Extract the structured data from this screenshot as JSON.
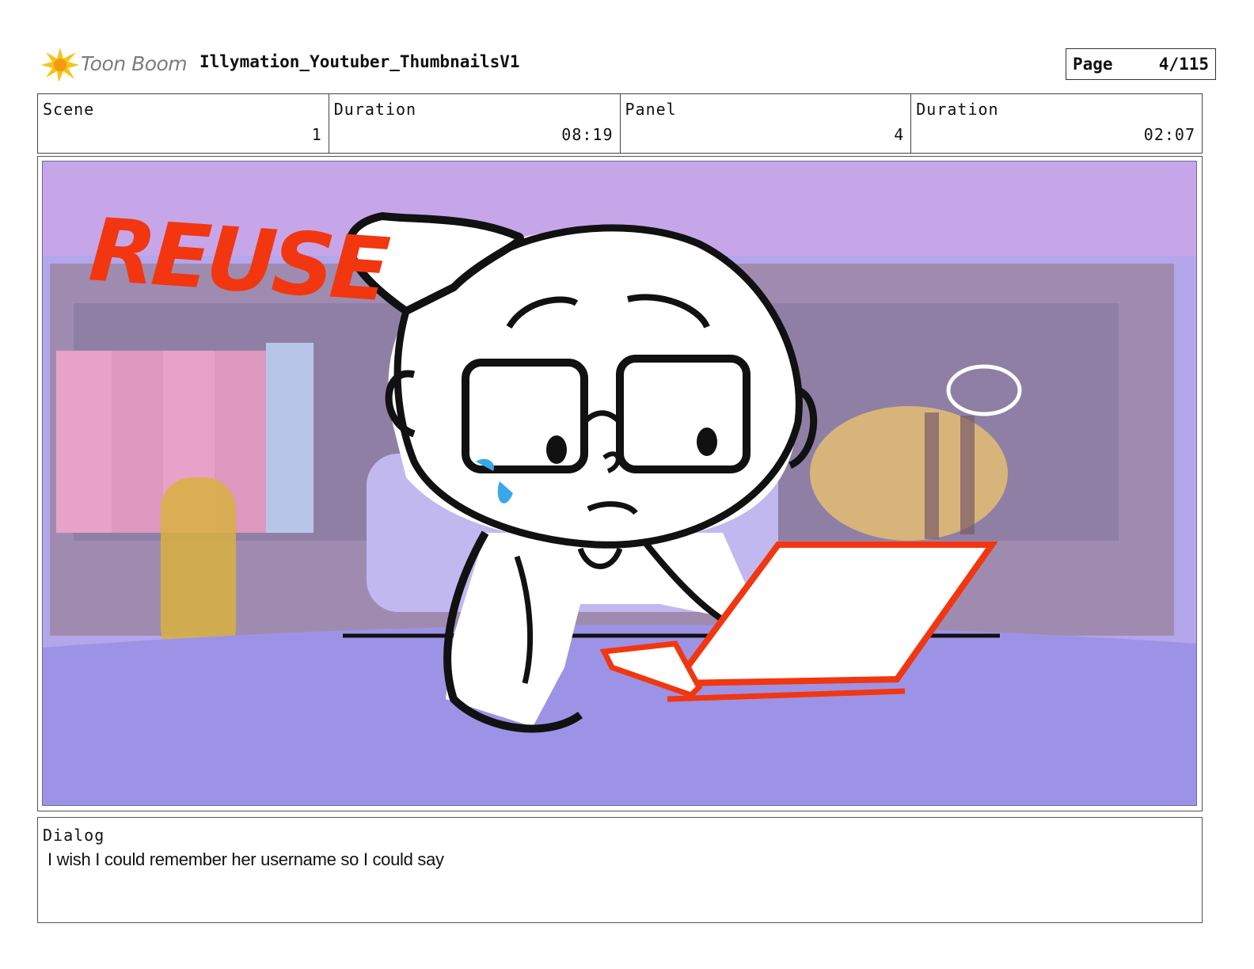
{
  "header": {
    "logo_text": "Toon Boom",
    "project_title": "Illymation_Youtuber_ThumbnailsV1",
    "page_label": "Page",
    "page_value": "4/115"
  },
  "info": {
    "scene_label": "Scene",
    "scene_value": "1",
    "scene_duration_label": "Duration",
    "scene_duration_value": "08:19",
    "panel_label": "Panel",
    "panel_value": "4",
    "panel_duration_label": "Duration",
    "panel_duration_value": "02:07"
  },
  "panel": {
    "overlay_text": "REUSE",
    "colors": {
      "background": "#a89ce6",
      "accent_red": "#f2360f",
      "tear_blue": "#3aa7e8"
    }
  },
  "dialog": {
    "label": "Dialog",
    "text": "I wish I could remember her username so I could say"
  }
}
